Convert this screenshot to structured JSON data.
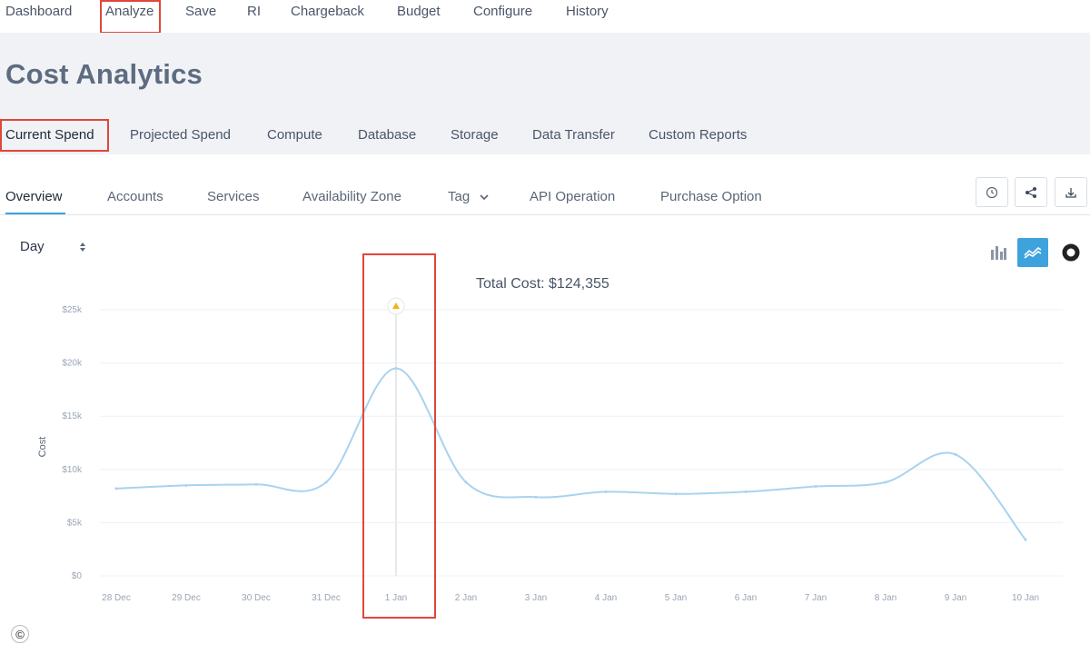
{
  "top_nav": {
    "items": [
      "Dashboard",
      "Analyze",
      "Save",
      "RI",
      "Chargeback",
      "Budget",
      "Configure",
      "History"
    ],
    "active": "Analyze"
  },
  "page": {
    "title": "Cost Analytics"
  },
  "sub_nav": {
    "items": [
      "Current Spend",
      "Projected Spend",
      "Compute",
      "Database",
      "Storage",
      "Data Transfer",
      "Custom Reports"
    ],
    "active": "Current Spend"
  },
  "tabs": {
    "items": [
      "Overview",
      "Accounts",
      "Services",
      "Availability Zone",
      "Tag",
      "API Operation",
      "Purchase Option"
    ],
    "active": "Overview",
    "tag_dropdown_icon": "chevron-down-icon"
  },
  "toolbar": {
    "icons": [
      "clock-icon",
      "share-icon",
      "download-icon"
    ]
  },
  "granularity": {
    "value": "Day",
    "icon": "sort-caret-icon"
  },
  "view_toggle": {
    "icons": [
      "bar-chart-icon",
      "line-chart-icon",
      "donut-chart-icon"
    ],
    "active": "line-chart-icon"
  },
  "colors": {
    "accent": "#3ea3dc",
    "line": "#a9d3ef",
    "highlight": "#e0463a",
    "marker": "#f5b21a"
  },
  "chart_data": {
    "type": "line",
    "title": "Total Cost: $124,355",
    "ylabel": "Cost",
    "xlabel": "",
    "x": [
      "28 Dec",
      "29 Dec",
      "30 Dec",
      "31 Dec",
      "1 Jan",
      "2 Jan",
      "3 Jan",
      "4 Jan",
      "5 Jan",
      "6 Jan",
      "7 Jan",
      "8 Jan",
      "9 Jan",
      "10 Jan"
    ],
    "y_ticks": [
      "$0",
      "$5k",
      "$10k",
      "$15k",
      "$20k",
      "$25k"
    ],
    "ylim": [
      0,
      25000
    ],
    "series": [
      {
        "values": [
          8200,
          8500,
          8600,
          8800,
          19500,
          8800,
          7400,
          7900,
          7700,
          7900,
          8400,
          8800,
          11400,
          3400
        ]
      }
    ],
    "highlighted_x": "1 Jan",
    "grid": true
  },
  "footer": {
    "copyright": "©"
  }
}
